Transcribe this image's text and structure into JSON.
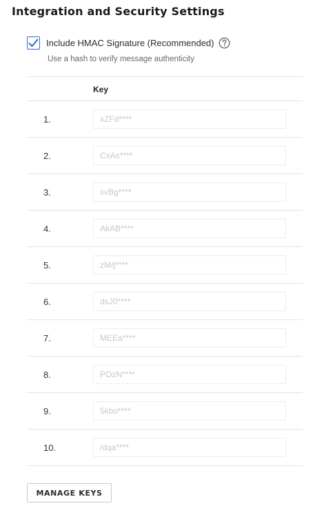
{
  "page": {
    "title": "Integration and Security Settings"
  },
  "hmac": {
    "checked": true,
    "label": "Include HMAC Signature (Recommended)",
    "helper_text": "Use a hash to verify message authenticity",
    "checkbox_color": "#2d6dbf",
    "help_icon": "question-circle-icon",
    "check_icon": "checkmark-icon"
  },
  "keys_table": {
    "header_key": "Key",
    "rows": [
      {
        "index": "1.",
        "value": "xZFd****"
      },
      {
        "index": "2.",
        "value": "CxAs****"
      },
      {
        "index": "3.",
        "value": "svBg****"
      },
      {
        "index": "4.",
        "value": "AkAB****"
      },
      {
        "index": "5.",
        "value": "zM/j****"
      },
      {
        "index": "6.",
        "value": "dsJ0****"
      },
      {
        "index": "7.",
        "value": "MEEa****"
      },
      {
        "index": "8.",
        "value": "POzN****"
      },
      {
        "index": "9.",
        "value": "5kbo****"
      },
      {
        "index": "10.",
        "value": "/dqa****"
      }
    ]
  },
  "actions": {
    "manage_keys_label": "MANAGE KEYS"
  }
}
